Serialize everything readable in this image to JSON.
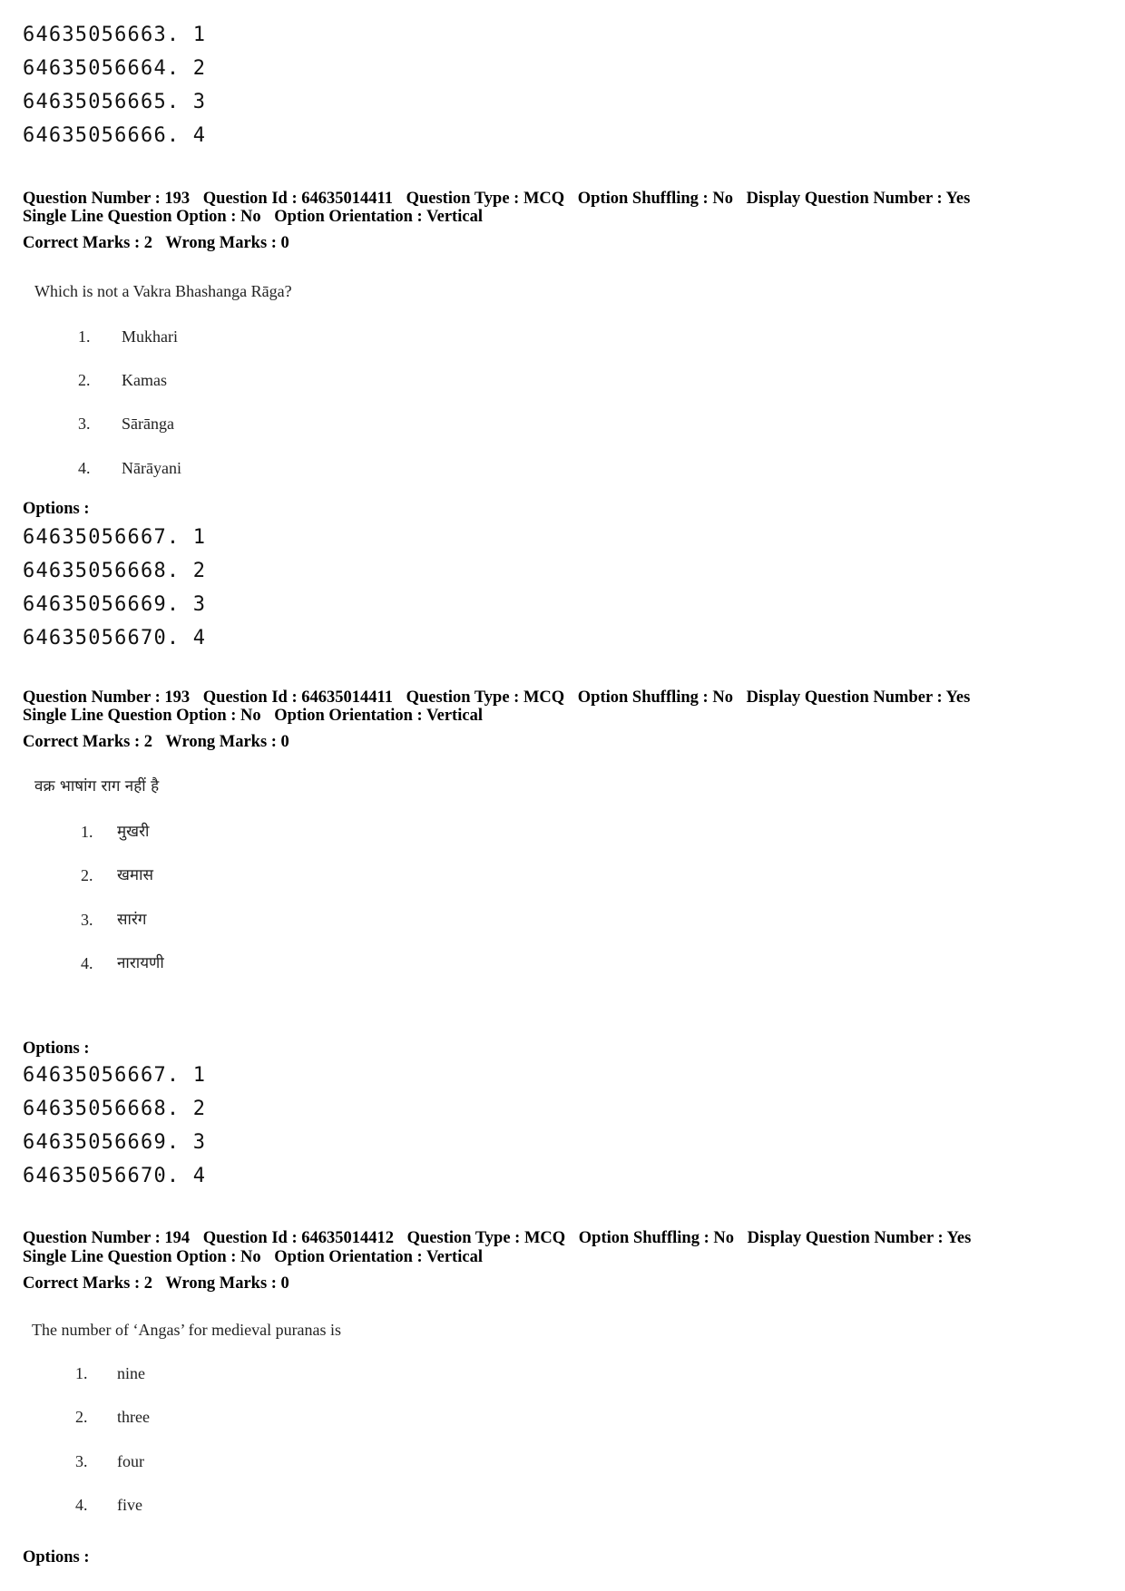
{
  "top_options": [
    {
      "id": "64635056663",
      "num": "1"
    },
    {
      "id": "64635056664",
      "num": "2"
    },
    {
      "id": "64635056665",
      "num": "3"
    },
    {
      "id": "64635056666",
      "num": "4"
    }
  ],
  "questions": [
    {
      "header_line1": {
        "question_number": "Question Number : 193",
        "question_id": "Question Id : 64635014411",
        "question_type": "Question Type : MCQ",
        "option_shuffling": "Option Shuffling : No",
        "display_question_number": "Display Question Number : Yes"
      },
      "header_line2": {
        "single_line": "Single Line Question Option : No",
        "orientation": "Option Orientation : Vertical"
      },
      "marks": {
        "correct": "Correct Marks : 2",
        "wrong": "Wrong Marks : 0"
      },
      "text": "Which is not a Vakra Bhashanga Rāga?",
      "choices": [
        {
          "num": "1.",
          "text": "Mukhari"
        },
        {
          "num": "2.",
          "text": "Kamas"
        },
        {
          "num": "3.",
          "text": "Sārānga"
        },
        {
          "num": "4.",
          "text": "Nārāyani"
        }
      ],
      "options_label": "Options :",
      "options": [
        {
          "id": "64635056667",
          "num": "1"
        },
        {
          "id": "64635056668",
          "num": "2"
        },
        {
          "id": "64635056669",
          "num": "3"
        },
        {
          "id": "64635056670",
          "num": "4"
        }
      ]
    },
    {
      "header_line1": {
        "question_number": "Question Number : 193",
        "question_id": "Question Id : 64635014411",
        "question_type": "Question Type : MCQ",
        "option_shuffling": "Option Shuffling : No",
        "display_question_number": "Display Question Number : Yes"
      },
      "header_line2": {
        "single_line": "Single Line Question Option : No",
        "orientation": "Option Orientation : Vertical"
      },
      "marks": {
        "correct": "Correct Marks : 2",
        "wrong": "Wrong Marks : 0"
      },
      "text": "वक्र भाषांग राग नहीं है",
      "choices": [
        {
          "num": "1.",
          "text": "मुखरी"
        },
        {
          "num": "2.",
          "text": "खमास"
        },
        {
          "num": "3.",
          "text": "सारंग"
        },
        {
          "num": "4.",
          "text": "नारायणी"
        }
      ],
      "options_label": "Options :",
      "options": [
        {
          "id": "64635056667",
          "num": "1"
        },
        {
          "id": "64635056668",
          "num": "2"
        },
        {
          "id": "64635056669",
          "num": "3"
        },
        {
          "id": "64635056670",
          "num": "4"
        }
      ]
    },
    {
      "header_line1": {
        "question_number": "Question Number : 194",
        "question_id": "Question Id : 64635014412",
        "question_type": "Question Type : MCQ",
        "option_shuffling": "Option Shuffling : No",
        "display_question_number": "Display Question Number : Yes"
      },
      "header_line2": {
        "single_line": "Single Line Question Option : No",
        "orientation": "Option Orientation : Vertical"
      },
      "marks": {
        "correct": "Correct Marks : 2",
        "wrong": "Wrong Marks : 0"
      },
      "text": "The number of ‘Angas’ for medieval puranas is",
      "choices": [
        {
          "num": "1.",
          "text": "nine"
        },
        {
          "num": "2.",
          "text": "three"
        },
        {
          "num": "3.",
          "text": "four"
        },
        {
          "num": "4.",
          "text": "five"
        }
      ],
      "options_label": "Options :"
    }
  ]
}
